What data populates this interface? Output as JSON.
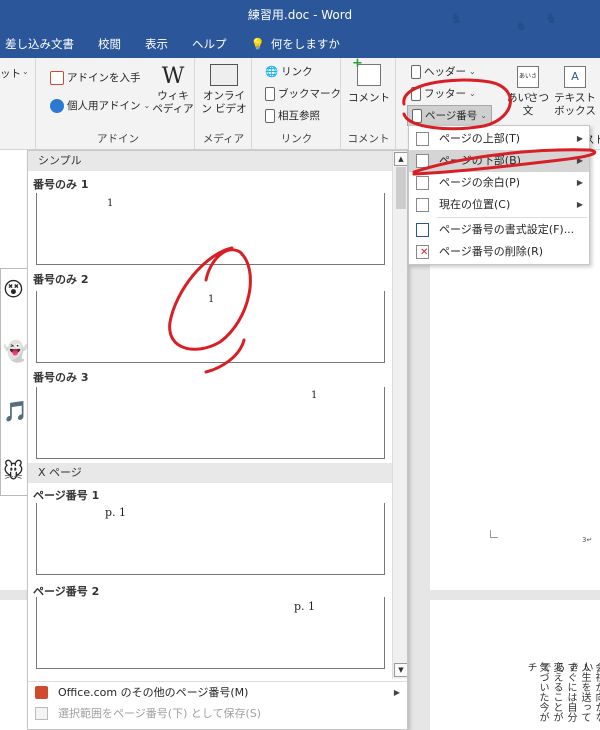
{
  "window": {
    "title": "練習用.doc - Word"
  },
  "menu_tabs": [
    "差し込み文書",
    "校閲",
    "表示",
    "ヘルプ",
    "何をしますか"
  ],
  "ribbon": {
    "left_partial": "ット",
    "addins": {
      "get": "アドインを入手",
      "personal": "個人用アドイン",
      "wiki": "ウィキ\nペディア",
      "label": "アドイン"
    },
    "media": {
      "video": "オンライ\nン ビデオ",
      "label": "メディア"
    },
    "links": {
      "link": "リンク",
      "bookmark": "ブックマーク",
      "crossref": "相互参照",
      "label": "リンク"
    },
    "comment": {
      "button": "コメント",
      "label": "コメント"
    },
    "header_footer": {
      "header": "ヘッダー",
      "footer": "フッター",
      "page_number": "ページ番号"
    },
    "greeting": "あいさつ\n文",
    "textbox": "テキスト\nボックス",
    "partial_right": "スト"
  },
  "gallery": {
    "sections": [
      {
        "header": "シンプル"
      },
      {
        "header": "X ページ"
      }
    ],
    "items": [
      {
        "title": "番号のみ 1",
        "sample": "1"
      },
      {
        "title": "番号のみ 2",
        "sample": "1"
      },
      {
        "title": "番号のみ 3",
        "sample": "1"
      },
      {
        "title": "ページ番号 1",
        "sample": "p. 1"
      },
      {
        "title": "ページ番号 2",
        "sample": "p. 1"
      }
    ],
    "footer": {
      "more": "Office.com のその他のページ番号(M)",
      "save": "選択範囲をページ番号(下) として保存(S)"
    }
  },
  "dropdown": {
    "items": [
      {
        "label": "ページの上部(T)",
        "submenu": true
      },
      {
        "label": "ページの下部(B)",
        "submenu": true,
        "highlighted": true
      },
      {
        "label": "ページの余白(P)",
        "submenu": true
      },
      {
        "label": "現在の位置(C)",
        "submenu": true
      },
      {
        "label": "ページ番号の書式設定(F)...",
        "submenu": false
      },
      {
        "label": "ページ番号の削除(R)",
        "submenu": false
      }
    ]
  },
  "document": {
    "vertical_text": [
      "会社が向かない",
      "人生を送ってき",
      "すぐには自分ら",
      "変えることがで",
      "気づいた今がチ"
    ],
    "page_mark": "3↵"
  },
  "colors": {
    "accent": "#2b579a",
    "annotation": "#d81f26",
    "highlight": "#d5d5d5"
  }
}
